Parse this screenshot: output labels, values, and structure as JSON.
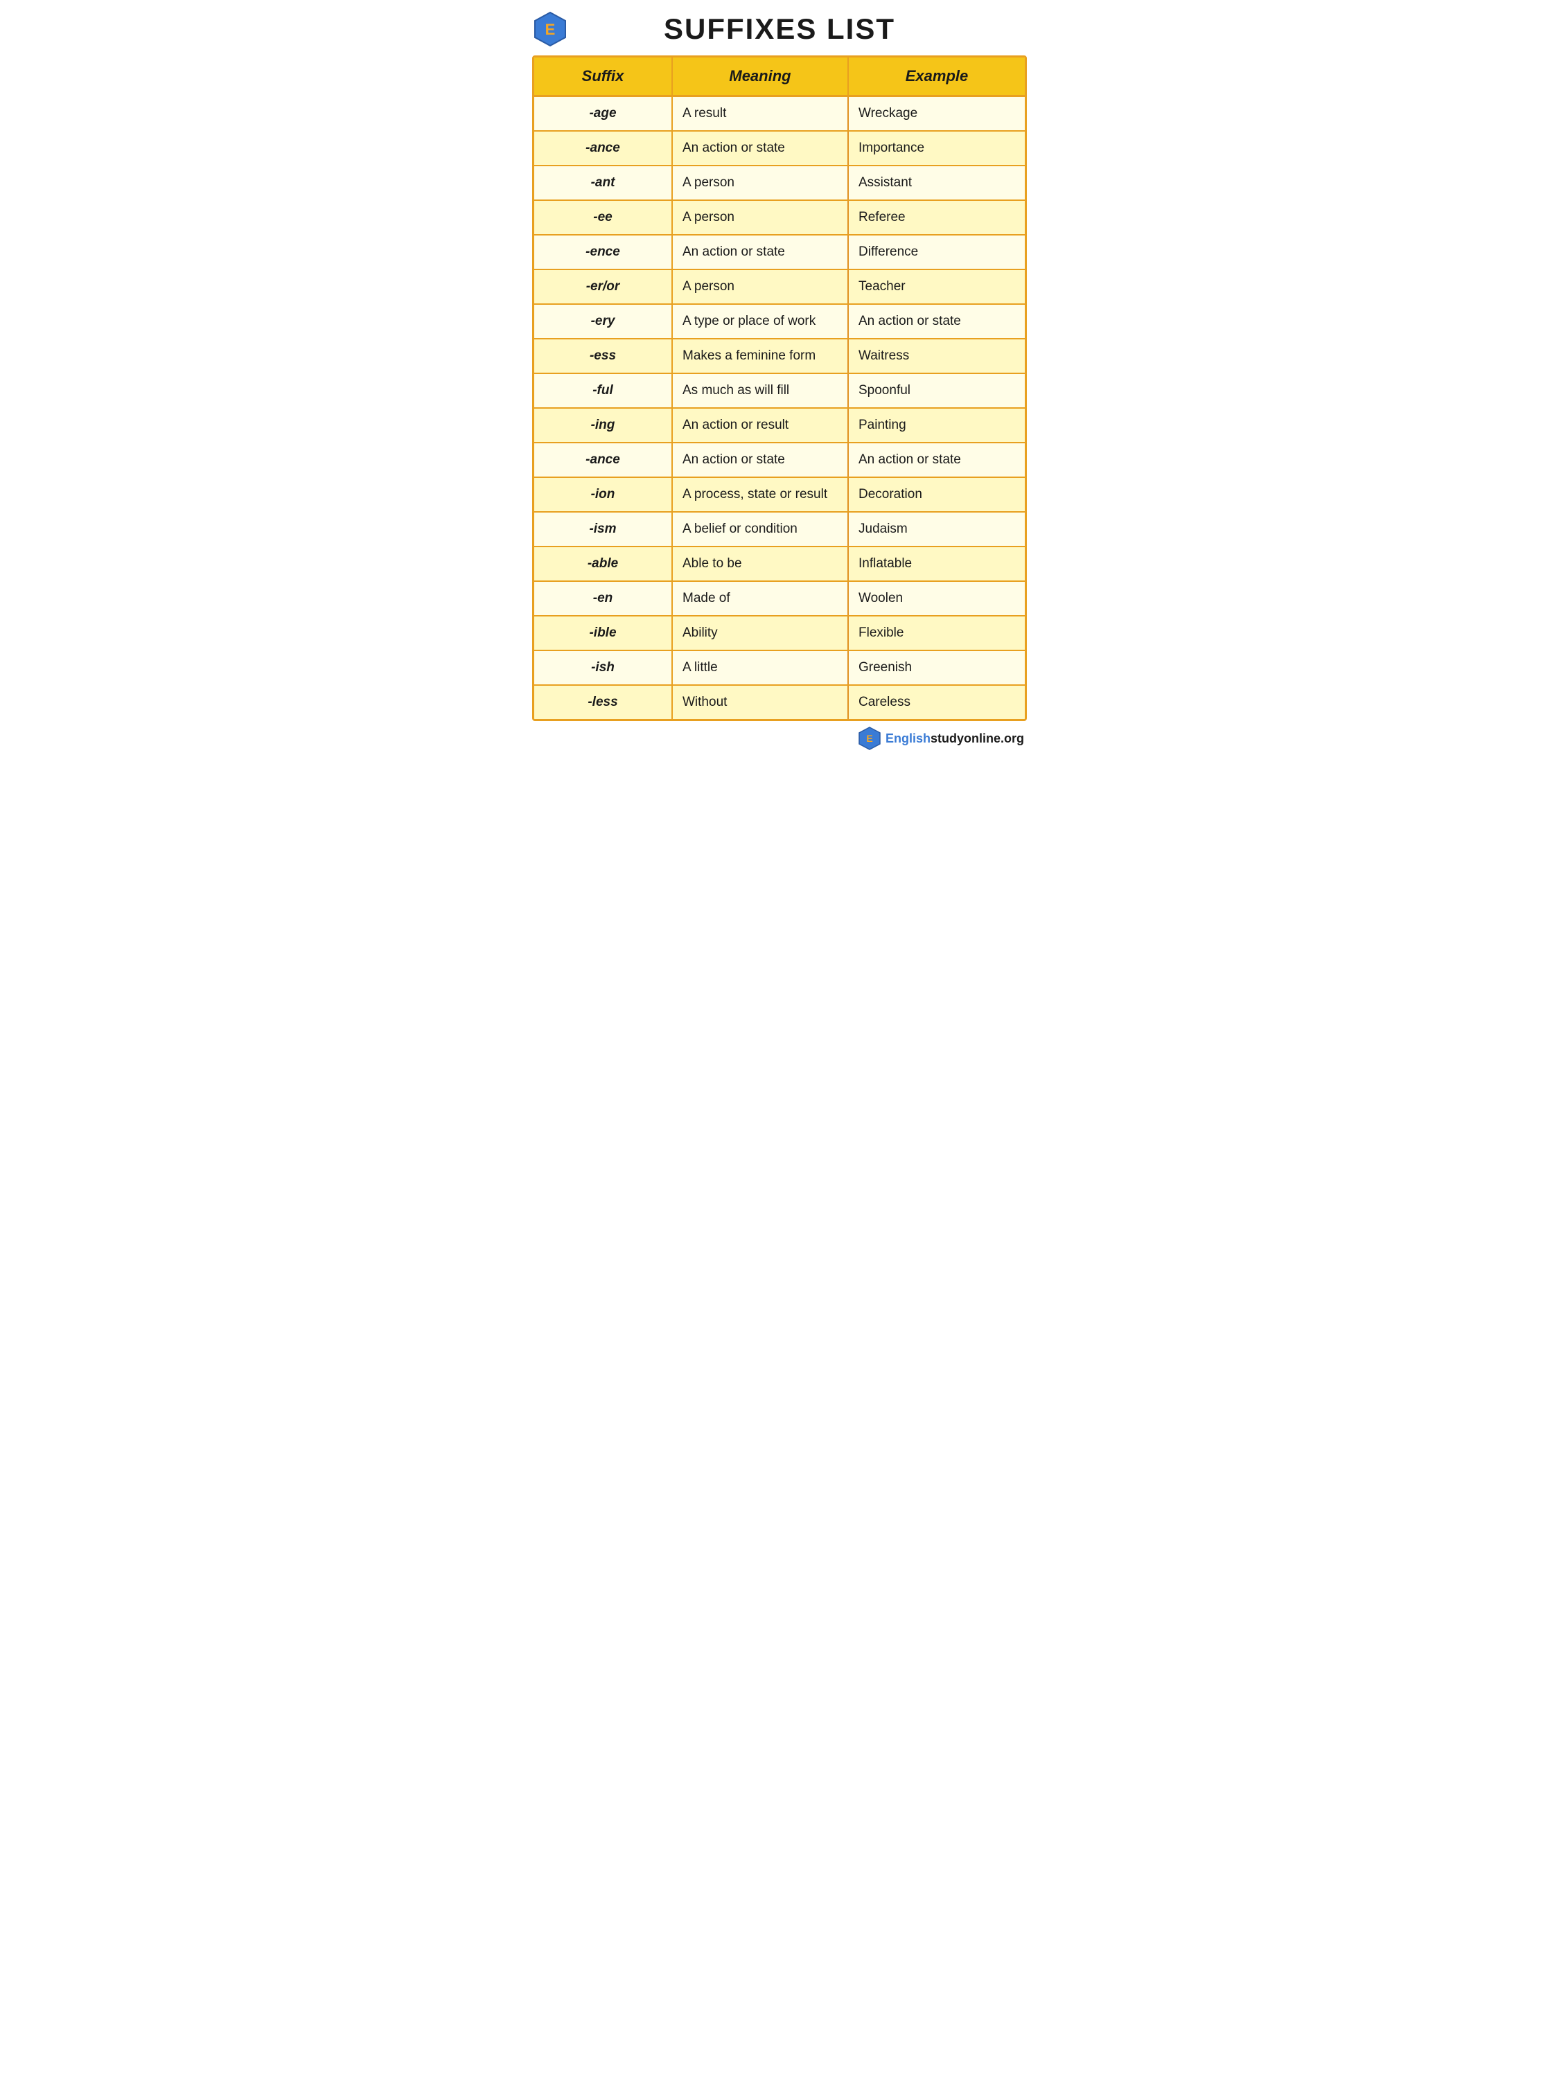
{
  "page": {
    "title": "SUFFIXES LIST",
    "logo_letter": "E",
    "footer_site": "Englishstudyonline.org"
  },
  "table": {
    "headers": [
      "Suffix",
      "Meaning",
      "Example"
    ],
    "rows": [
      {
        "suffix": "-age",
        "meaning": "A result",
        "example": "Wreckage"
      },
      {
        "suffix": "-ance",
        "meaning": "An action or state",
        "example": "Importance"
      },
      {
        "suffix": "-ant",
        "meaning": "A person",
        "example": "Assistant"
      },
      {
        "suffix": "-ee",
        "meaning": "A person",
        "example": "Referee"
      },
      {
        "suffix": "-ence",
        "meaning": "An action or state",
        "example": "Difference"
      },
      {
        "suffix": "-er/or",
        "meaning": "A person",
        "example": "Teacher"
      },
      {
        "suffix": "-ery",
        "meaning": "A type or place of work",
        "example": "An action or state"
      },
      {
        "suffix": "-ess",
        "meaning": "Makes a feminine form",
        "example": "Waitress"
      },
      {
        "suffix": "-ful",
        "meaning": "As much as will fill",
        "example": "Spoonful"
      },
      {
        "suffix": "-ing",
        "meaning": "An action or result",
        "example": "Painting"
      },
      {
        "suffix": "-ance",
        "meaning": "An action or state",
        "example": "An action or state"
      },
      {
        "suffix": "-ion",
        "meaning": "A process, state or result",
        "example": "Decoration"
      },
      {
        "suffix": "-ism",
        "meaning": "A belief or condition",
        "example": "Judaism"
      },
      {
        "suffix": "-able",
        "meaning": "Able to be",
        "example": "Inflatable"
      },
      {
        "suffix": "-en",
        "meaning": "Made of",
        "example": "Woolen"
      },
      {
        "suffix": "-ible",
        "meaning": "Ability",
        "example": "Flexible"
      },
      {
        "suffix": "-ish",
        "meaning": "A little",
        "example": "Greenish"
      },
      {
        "suffix": "-less",
        "meaning": "Without",
        "example": "Careless"
      }
    ]
  }
}
